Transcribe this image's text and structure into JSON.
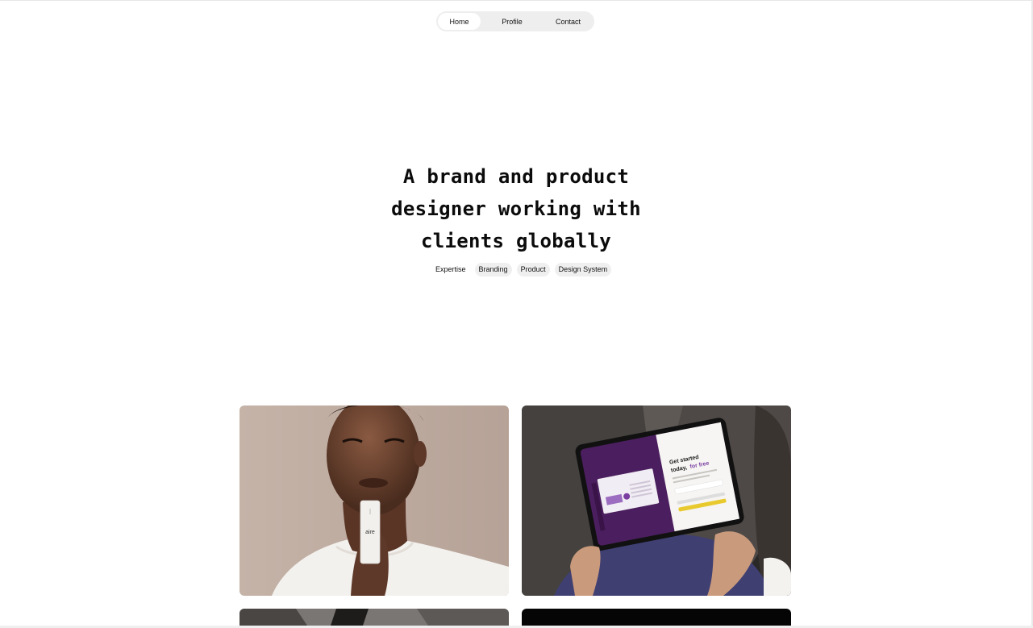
{
  "nav": {
    "items": [
      {
        "label": "Home"
      },
      {
        "label": "Profile"
      },
      {
        "label": "Contact"
      }
    ],
    "active": "Home"
  },
  "hero": {
    "line1": "A brand and product",
    "line2": "designer working with",
    "line3": "clients globally"
  },
  "tags": {
    "label": "Expertise",
    "items": [
      "Branding",
      "Product",
      "Design System"
    ]
  },
  "cards": {
    "product_label": "aire",
    "tablet_headline_1": "Get started",
    "tablet_headline_2": "today,",
    "tablet_headline_accent": "for free"
  },
  "colors": {
    "pill_bg": "#eeeeee",
    "accent_purple": "#6b2d86",
    "accent_yellow": "#e8c92e"
  }
}
